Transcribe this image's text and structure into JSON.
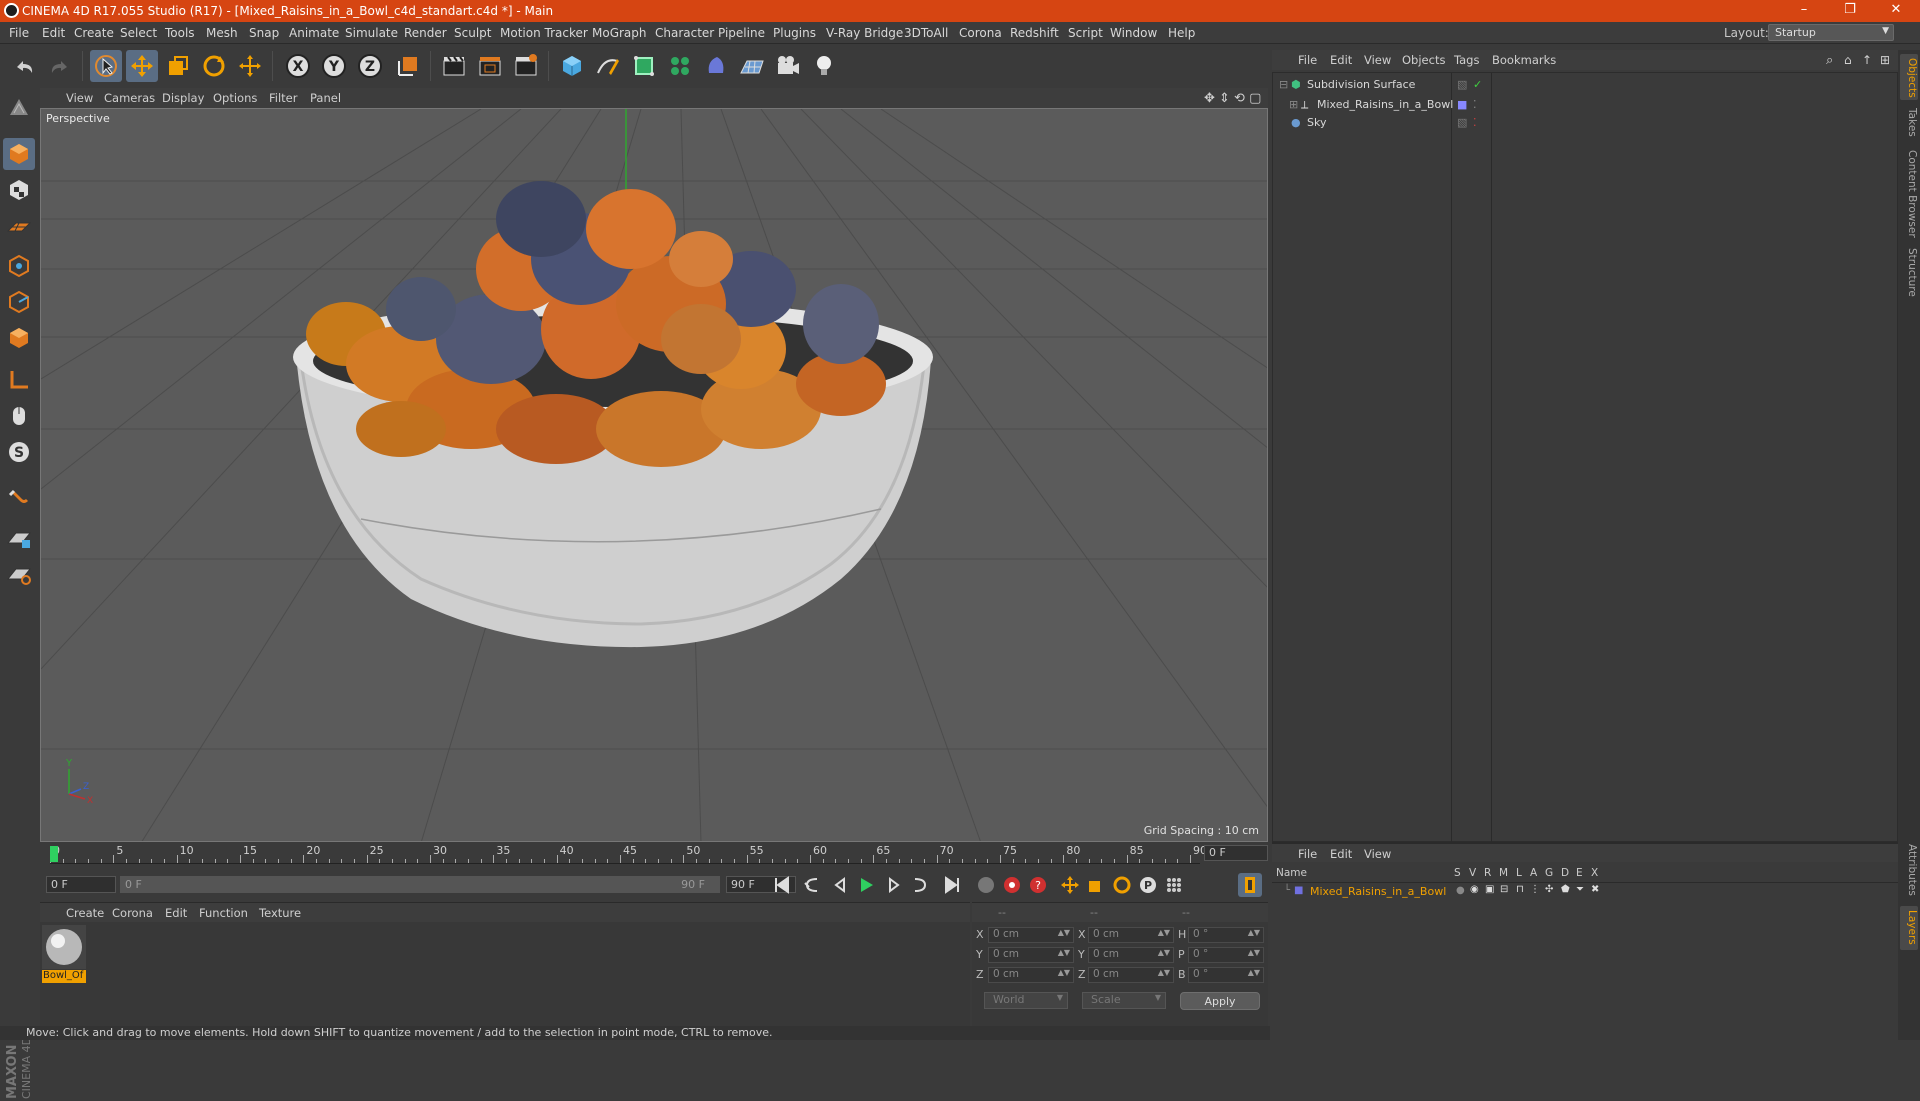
{
  "window": {
    "title": "CINEMA 4D R17.055 Studio (R17) - [Mixed_Raisins_in_a_Bowl_c4d_standart.c4d *] - Main",
    "controls": [
      "–",
      "❐",
      "✕"
    ]
  },
  "menubar": {
    "items": [
      "File",
      "Edit",
      "Create",
      "Select",
      "Tools",
      "Mesh",
      "Snap",
      "Animate",
      "Simulate",
      "Render",
      "Sculpt",
      "Motion Tracker",
      "MoGraph",
      "Character",
      "Pipeline",
      "Plugins",
      "V-Ray Bridge",
      "3DToAll",
      "Corona",
      "Redshift",
      "Script",
      "Window",
      "Help"
    ],
    "layout_label": "Layout:",
    "layout_value": "Startup"
  },
  "toolbar": {
    "axis_x": "X",
    "axis_y": "Y",
    "axis_z": "Z"
  },
  "viewport": {
    "menu": [
      "View",
      "Cameras",
      "Display",
      "Options",
      "Filter",
      "Panel"
    ],
    "label": "Perspective",
    "grid_spacing": "Grid Spacing : 10 cm",
    "axis_labels": {
      "y": "Y",
      "z": "Z",
      "x": "X"
    }
  },
  "timeline": {
    "ticks": [
      "0",
      "5",
      "10",
      "15",
      "20",
      "25",
      "30",
      "35",
      "40",
      "45",
      "50",
      "55",
      "60",
      "65",
      "70",
      "75",
      "80",
      "85",
      "90"
    ],
    "current_frame": "0 F",
    "start_field": "0 F",
    "range_start": "0 F",
    "range_end": "90 F",
    "end_field": "90 F"
  },
  "material_manager": {
    "menu": [
      "Create",
      "Corona",
      "Edit",
      "Function",
      "Texture"
    ],
    "materials": [
      {
        "name": "Bowl_Of"
      }
    ]
  },
  "coordinates": {
    "headers": [
      "--",
      "--",
      "--"
    ],
    "rows": [
      {
        "axis": "X",
        "pos": "0 cm",
        "axis2": "X",
        "size": "0 cm",
        "rot_label": "H",
        "rot": "0 °"
      },
      {
        "axis": "Y",
        "pos": "0 cm",
        "axis2": "Y",
        "size": "0 cm",
        "rot_label": "P",
        "rot": "0 °"
      },
      {
        "axis": "Z",
        "pos": "0 cm",
        "axis2": "Z",
        "size": "0 cm",
        "rot_label": "B",
        "rot": "0 °"
      }
    ],
    "mode": "World",
    "scale": "Scale",
    "apply": "Apply"
  },
  "statusbar": {
    "text": "Move: Click and drag to move elements. Hold down SHIFT to quantize movement / add to the selection in point mode, CTRL to remove."
  },
  "object_manager": {
    "menu": [
      "File",
      "Edit",
      "View",
      "Objects",
      "Tags",
      "Bookmarks"
    ],
    "objects": [
      {
        "name": "Subdivision Surface",
        "color": "#40c080"
      },
      {
        "name": "Mixed_Raisins_in_a_Bowl",
        "color": "#8888ff"
      },
      {
        "name": "Sky",
        "color": "#6a9ad0"
      }
    ]
  },
  "layer_manager": {
    "menu": [
      "File",
      "Edit",
      "View"
    ],
    "headers": [
      "Name",
      "S",
      "V",
      "R",
      "M",
      "L",
      "A",
      "G",
      "D",
      "E",
      "X"
    ],
    "layers": [
      {
        "name": "Mixed_Raisins_in_a_Bowl",
        "color": "#7070e0"
      }
    ]
  },
  "side_tabs": {
    "top": [
      "Objects",
      "Takes",
      "Content Browser",
      "Structure"
    ],
    "bottom": [
      "Attributes",
      "Layers"
    ]
  },
  "colors": {
    "titlebar": "#d64512",
    "selection": "#f0a000",
    "viewport_bg": "#5b5b5b"
  }
}
